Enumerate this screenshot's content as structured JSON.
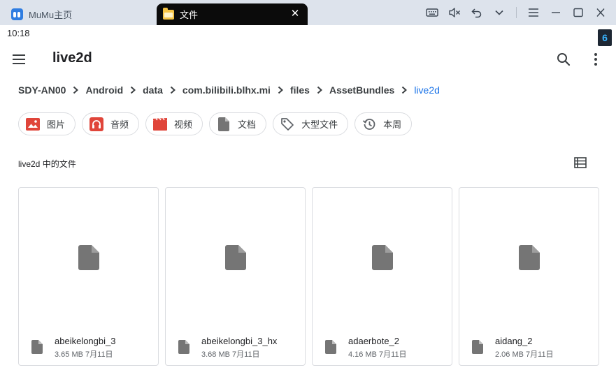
{
  "emulator": {
    "home_tab_label": "MuMu主页",
    "active_tab_label": "文件",
    "close_glyph": "✕"
  },
  "status": {
    "time": "10:18",
    "badge": "6"
  },
  "appbar": {
    "title": "live2d"
  },
  "breadcrumb": [
    "SDY-AN00",
    "Android",
    "data",
    "com.bilibili.blhx.mi",
    "files",
    "AssetBundles",
    "live2d"
  ],
  "chips": [
    {
      "label": "图片",
      "icon": "image-icon",
      "color": "#e0453a"
    },
    {
      "label": "音频",
      "icon": "headphones-icon",
      "color": "#e0453a"
    },
    {
      "label": "视频",
      "icon": "movie-icon",
      "color": "#e0453a"
    },
    {
      "label": "文档",
      "icon": "document-icon",
      "color": "#757575"
    },
    {
      "label": "大型文件",
      "icon": "tag-icon",
      "color": "#5f6368"
    },
    {
      "label": "本周",
      "icon": "history-icon",
      "color": "#5f6368"
    }
  ],
  "section": {
    "title": "live2d 中的文件"
  },
  "files": [
    {
      "name": "abeikelongbi_3",
      "meta": "3.65 MB 7月11日"
    },
    {
      "name": "abeikelongbi_3_hx",
      "meta": "3.68 MB 7月11日"
    },
    {
      "name": "adaerbote_2",
      "meta": "4.16 MB 7月11日"
    },
    {
      "name": "aidang_2",
      "meta": "2.06 MB 7月11日"
    }
  ],
  "colors": {
    "accent": "#1a73e8",
    "file_icon": "#757575",
    "chip_red": "#e0453a"
  }
}
